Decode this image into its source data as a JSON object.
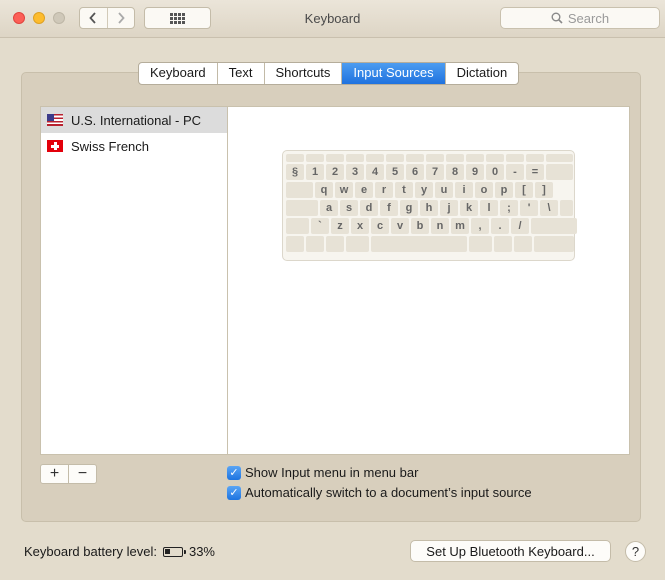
{
  "window": {
    "title": "Keyboard"
  },
  "toolbar": {
    "back_icon": "chevron-left-icon",
    "forward_icon": "chevron-right-icon",
    "grid_icon": "grid-icon",
    "search_placeholder": "Search"
  },
  "tabs": [
    {
      "label": "Keyboard",
      "active": false
    },
    {
      "label": "Text",
      "active": false
    },
    {
      "label": "Shortcuts",
      "active": false
    },
    {
      "label": "Input Sources",
      "active": true
    },
    {
      "label": "Dictation",
      "active": false
    }
  ],
  "input_sources": [
    {
      "label": "U.S. International - PC",
      "flag": "us-flag-icon",
      "selected": true
    },
    {
      "label": "Swiss French",
      "flag": "swiss-flag-icon",
      "selected": false
    }
  ],
  "keyboard_preview": {
    "row1": [
      "§",
      "1",
      "2",
      "3",
      "4",
      "5",
      "6",
      "7",
      "8",
      "9",
      "0",
      "-",
      "="
    ],
    "row2": [
      "q",
      "w",
      "e",
      "r",
      "t",
      "y",
      "u",
      "i",
      "o",
      "p",
      "[",
      "]"
    ],
    "row3": [
      "a",
      "s",
      "d",
      "f",
      "g",
      "h",
      "j",
      "k",
      "l",
      ";",
      "'",
      "\\"
    ],
    "row4": [
      "`",
      "z",
      "x",
      "c",
      "v",
      "b",
      "n",
      "m",
      ",",
      ".",
      "/"
    ]
  },
  "list_controls": {
    "add": "+",
    "remove": "−"
  },
  "options": [
    {
      "label": "Show Input menu in menu bar",
      "checked": true
    },
    {
      "label": "Automatically switch to a document’s input source",
      "checked": true
    }
  ],
  "footer": {
    "battery_label": "Keyboard battery level:",
    "battery_percent": "33%",
    "battery_level": 0.33,
    "bluetooth_button": "Set Up Bluetooth Keyboard...",
    "help": "?"
  },
  "colors": {
    "accent": "#1f72df",
    "traffic_close": "#fc5f57",
    "traffic_min": "#fdbc2e"
  }
}
